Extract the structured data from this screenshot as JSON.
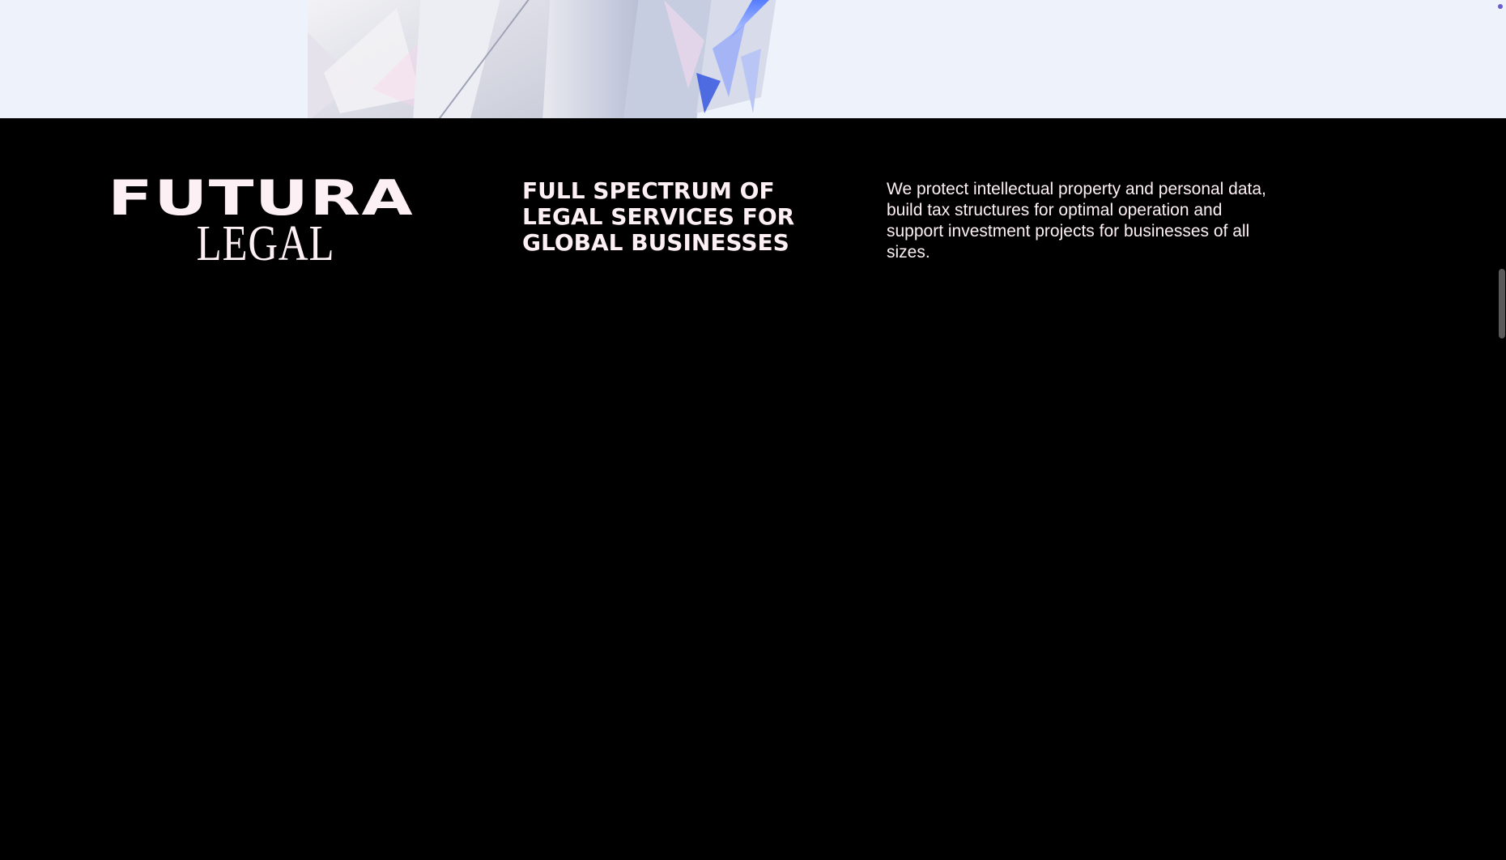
{
  "hero": {
    "image": "crystal-render",
    "background_color": "#eef2fb"
  },
  "footer": {
    "background_color": "#000000",
    "text_color": "#fdf0f4",
    "logo": {
      "line1": "FUTURA",
      "line2": "LEGAL"
    },
    "headline": "FULL SPECTRUM OF LEGAL SERVICES FOR GLOBAL BUSINESSES",
    "description": "We protect intellectual property and personal data, build tax structures for optimal operation and support investment projects for businesses of all sizes."
  },
  "scrollbar": {
    "thumb_color": "#5a5a5a"
  }
}
